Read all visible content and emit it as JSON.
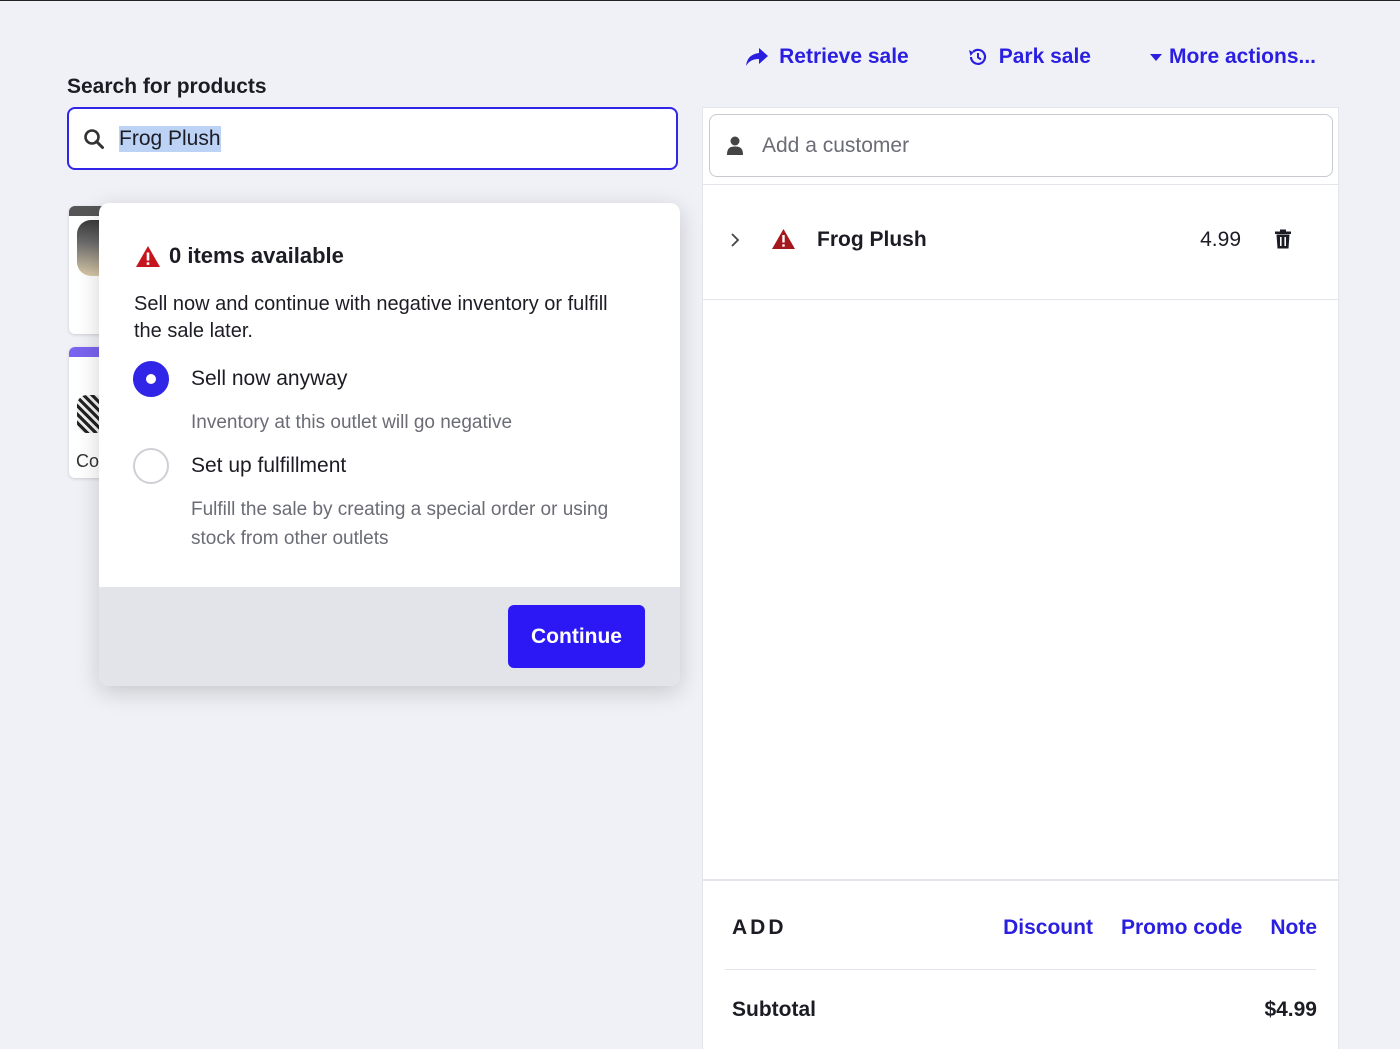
{
  "top_actions": {
    "retrieve_sale": "Retrieve sale",
    "park_sale": "Park sale",
    "more_actions": "More actions..."
  },
  "search": {
    "label": "Search for products",
    "value": "Frog Plush"
  },
  "tiles": [
    {
      "label": ""
    },
    {
      "label": "Co"
    }
  ],
  "popup": {
    "title": "0 items available",
    "description": "Sell now and continue with negative inventory or fulfill the sale later.",
    "options": [
      {
        "label": "Sell now anyway",
        "sub": "Inventory at this outlet will go negative",
        "selected": true
      },
      {
        "label": "Set up fulfillment",
        "sub": "Fulfill the sale by creating a special order or using stock from other outlets",
        "selected": false
      }
    ],
    "continue_label": "Continue"
  },
  "sale": {
    "customer_placeholder": "Add a customer",
    "line_items": [
      {
        "name": "Frog Plush",
        "price": "4.99"
      }
    ],
    "add_label": "ADD",
    "add_links": {
      "discount": "Discount",
      "promo_code": "Promo code",
      "note": "Note"
    },
    "subtotal_label": "Subtotal",
    "subtotal_value": "$4.99"
  },
  "colors": {
    "accent": "#2a1fe0",
    "button": "#2b18f5",
    "warning": "#c4161c",
    "background": "#f0f1f7"
  }
}
